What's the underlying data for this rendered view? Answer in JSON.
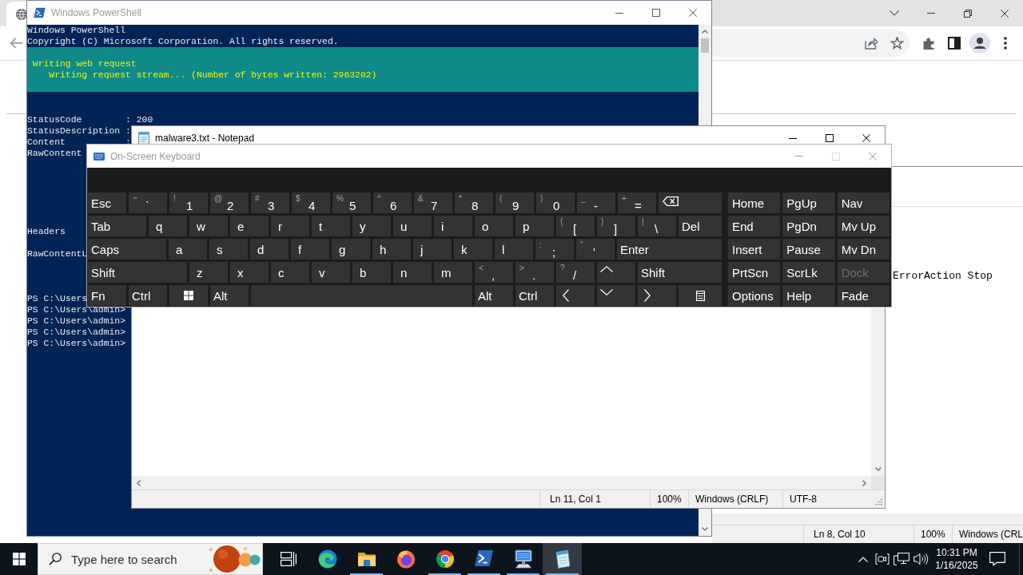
{
  "terminal": {
    "title": "Windows PowerShell",
    "active": false,
    "header_lines": [
      "Windows PowerShell",
      "Copyright (C) Microsoft Corporation. All rights reserved."
    ],
    "progress": {
      "activity": "Writing web request",
      "status": "Writing request stream... (Number of bytes written: 2963202)"
    },
    "output_blocks": [
      [
        "StatusCode        : 200",
        "StatusDescription :",
        "Content           :",
        "RawContent"
      ],
      [
        "Headers"
      ],
      [
        "RawContentL"
      ],
      [
        "PS C:\\Users",
        "PS C:\\Users\\admin>",
        "PS C:\\Users\\admin>",
        "PS C:\\Users\\admin>",
        "PS C:\\Users\\admin>"
      ]
    ]
  },
  "notepad": {
    "title": "malware3.txt - Notepad",
    "active": true,
    "status_bar": [
      "Ln 11, Col 1",
      "100%",
      "Windows (CRLF)",
      "UTF-8"
    ]
  },
  "on_screen_keyboard": {
    "title": "On-Screen Keyboard",
    "active": false,
    "maximize_disabled": true,
    "rows": [
      [
        {
          "kind": "text",
          "label": "Esc"
        },
        {
          "kind": "char",
          "shift": "~",
          "label": "`"
        },
        {
          "kind": "char",
          "shift": "!",
          "label": "1"
        },
        {
          "kind": "char",
          "shift": "@",
          "label": "2"
        },
        {
          "kind": "char",
          "shift": "#",
          "label": "3"
        },
        {
          "kind": "char",
          "shift": "$",
          "label": "4"
        },
        {
          "kind": "char",
          "shift": "%",
          "label": "5"
        },
        {
          "kind": "char",
          "shift": "^",
          "label": "6"
        },
        {
          "kind": "char",
          "shift": "&",
          "label": "7"
        },
        {
          "kind": "char",
          "shift": "*",
          "label": "8"
        },
        {
          "kind": "char",
          "shift": "(",
          "label": "9"
        },
        {
          "kind": "char",
          "shift": ")",
          "label": "0"
        },
        {
          "kind": "char",
          "shift": "_",
          "label": "-"
        },
        {
          "kind": "char",
          "shift": "+",
          "label": "="
        },
        {
          "kind": "backspace"
        }
      ],
      [
        {
          "kind": "text",
          "label": "Tab"
        },
        {
          "kind": "letter",
          "label": "q"
        },
        {
          "kind": "letter",
          "label": "w"
        },
        {
          "kind": "letter",
          "label": "e"
        },
        {
          "kind": "letter",
          "label": "r"
        },
        {
          "kind": "letter",
          "label": "t"
        },
        {
          "kind": "letter",
          "label": "y"
        },
        {
          "kind": "letter",
          "label": "u"
        },
        {
          "kind": "letter",
          "label": "i"
        },
        {
          "kind": "letter",
          "label": "o"
        },
        {
          "kind": "letter",
          "label": "p"
        },
        {
          "kind": "char",
          "shift": "{",
          "label": "["
        },
        {
          "kind": "char",
          "shift": "}",
          "label": "]"
        },
        {
          "kind": "char",
          "shift": "|",
          "label": "\\"
        },
        {
          "kind": "text",
          "label": "Del"
        }
      ],
      [
        {
          "kind": "text",
          "label": "Caps"
        },
        {
          "kind": "letter",
          "label": "a"
        },
        {
          "kind": "letter",
          "label": "s"
        },
        {
          "kind": "letter",
          "label": "d"
        },
        {
          "kind": "letter",
          "label": "f"
        },
        {
          "kind": "letter",
          "label": "g"
        },
        {
          "kind": "letter",
          "label": "h"
        },
        {
          "kind": "letter",
          "label": "j"
        },
        {
          "kind": "letter",
          "label": "k"
        },
        {
          "kind": "letter",
          "label": "l"
        },
        {
          "kind": "char",
          "shift": ":",
          "label": ";"
        },
        {
          "kind": "char",
          "shift": "\"",
          "label": "'"
        },
        {
          "kind": "text",
          "label": "Enter"
        }
      ],
      [
        {
          "kind": "text",
          "label": "Shift"
        },
        {
          "kind": "letter",
          "label": "z"
        },
        {
          "kind": "letter",
          "label": "x"
        },
        {
          "kind": "letter",
          "label": "c"
        },
        {
          "kind": "letter",
          "label": "v"
        },
        {
          "kind": "letter",
          "label": "b"
        },
        {
          "kind": "letter",
          "label": "n"
        },
        {
          "kind": "letter",
          "label": "m"
        },
        {
          "kind": "char",
          "shift": "<",
          "label": ","
        },
        {
          "kind": "char",
          "shift": ">",
          "label": "."
        },
        {
          "kind": "char",
          "shift": "?",
          "label": "/"
        },
        {
          "kind": "up"
        },
        {
          "kind": "text",
          "label": "Shift"
        }
      ],
      [
        {
          "kind": "text",
          "label": "Fn"
        },
        {
          "kind": "text",
          "label": "Ctrl"
        },
        {
          "kind": "windows"
        },
        {
          "kind": "text",
          "label": "Alt"
        },
        {
          "kind": "space"
        },
        {
          "kind": "text",
          "label": "Alt"
        },
        {
          "kind": "text",
          "label": "Ctrl"
        },
        {
          "kind": "left"
        },
        {
          "kind": "down"
        },
        {
          "kind": "right"
        },
        {
          "kind": "menu"
        }
      ]
    ],
    "nav_keys": [
      {
        "label": "Home",
        "disabled": false
      },
      {
        "label": "PgUp",
        "disabled": false
      },
      {
        "label": "Nav",
        "disabled": false
      },
      {
        "label": "End",
        "disabled": false
      },
      {
        "label": "PgDn",
        "disabled": false
      },
      {
        "label": "Mv Up",
        "disabled": false
      },
      {
        "label": "Insert",
        "disabled": false
      },
      {
        "label": "Pause",
        "disabled": false
      },
      {
        "label": "Mv Dn",
        "disabled": false
      },
      {
        "label": "PrtScn",
        "disabled": false
      },
      {
        "label": "ScrLk",
        "disabled": false
      },
      {
        "label": "Dock",
        "disabled": true
      },
      {
        "label": "Options",
        "disabled": false
      },
      {
        "label": "Help",
        "disabled": false
      },
      {
        "label": "Fade",
        "disabled": false
      }
    ]
  },
  "background_editor": {
    "text": "ErrorAction Stop",
    "status_bar": [
      "Ln 8, Col 10",
      "100%",
      "Windows (CRL"
    ]
  },
  "taskbar": {
    "search": {
      "placeholder": "Type here to search"
    },
    "apps": [
      {
        "running": false,
        "selected": false
      },
      {
        "running": true,
        "selected": false
      },
      {
        "running": false,
        "selected": false
      },
      {
        "running": true,
        "selected": false
      },
      {
        "running": true,
        "selected": false
      },
      {
        "running": true,
        "selected": false
      },
      {
        "running": true,
        "selected": true
      }
    ],
    "clock": {
      "time": "10:31 PM",
      "date": "1/16/2025"
    }
  }
}
